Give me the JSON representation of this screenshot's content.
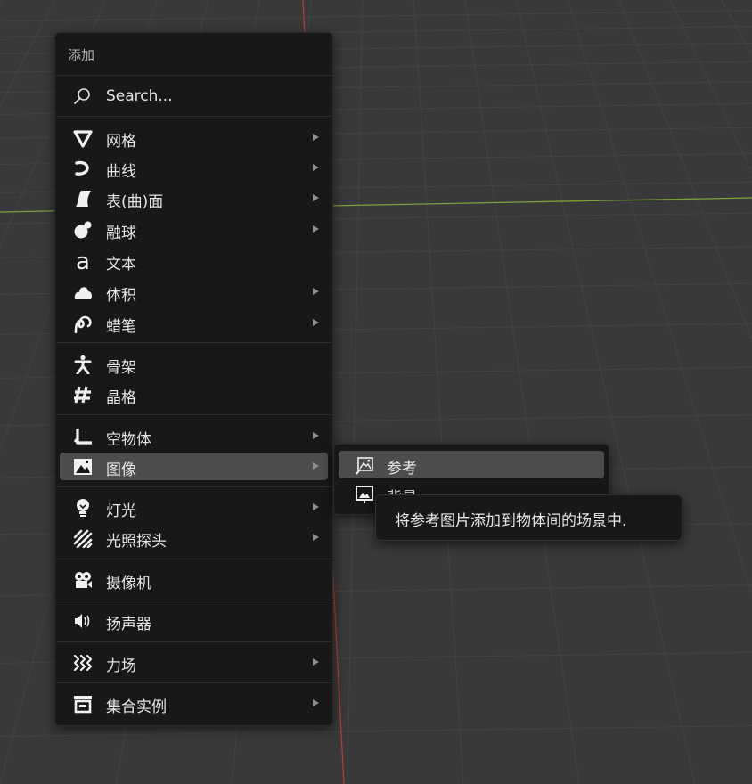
{
  "menu": {
    "title": "添加",
    "search_label": "Search...",
    "items": [
      {
        "label": "网格",
        "icon": "mesh-icon",
        "submenu": true
      },
      {
        "label": "曲线",
        "icon": "curve-icon",
        "submenu": true
      },
      {
        "label": "表(曲)面",
        "icon": "surface-icon",
        "submenu": true
      },
      {
        "label": "融球",
        "icon": "metaball-icon",
        "submenu": true
      },
      {
        "label": "文本",
        "icon": "text-icon",
        "submenu": false
      },
      {
        "label": "体积",
        "icon": "volume-icon",
        "submenu": true
      },
      {
        "label": "蜡笔",
        "icon": "grease-pencil-icon",
        "submenu": true
      },
      {
        "label": "骨架",
        "icon": "armature-icon",
        "submenu": false
      },
      {
        "label": "晶格",
        "icon": "lattice-icon",
        "submenu": false
      },
      {
        "label": "空物体",
        "icon": "empty-icon",
        "submenu": true
      },
      {
        "label": "图像",
        "icon": "image-icon",
        "submenu": true,
        "active": true
      },
      {
        "label": "灯光",
        "icon": "light-icon",
        "submenu": true
      },
      {
        "label": "光照探头",
        "icon": "light-probe-icon",
        "submenu": true
      },
      {
        "label": "摄像机",
        "icon": "camera-icon",
        "submenu": false
      },
      {
        "label": "扬声器",
        "icon": "speaker-icon",
        "submenu": false
      },
      {
        "label": "力场",
        "icon": "force-field-icon",
        "submenu": true
      },
      {
        "label": "集合实例",
        "icon": "collection-instance-icon",
        "submenu": true
      }
    ]
  },
  "submenu": {
    "items": [
      {
        "label": "参考",
        "icon": "image-reference-icon",
        "active": true
      },
      {
        "label": "背景",
        "icon": "image-background-icon"
      }
    ]
  },
  "tooltip": {
    "text": "将参考图片添加到物体间的场景中."
  },
  "colors": {
    "menu_bg": "#181818",
    "highlight": "#4d4d4d",
    "text": "#e6e6e6",
    "viewport_bg": "#393939",
    "x_axis": "#b63a3a",
    "y_axis": "#7aa03a"
  }
}
